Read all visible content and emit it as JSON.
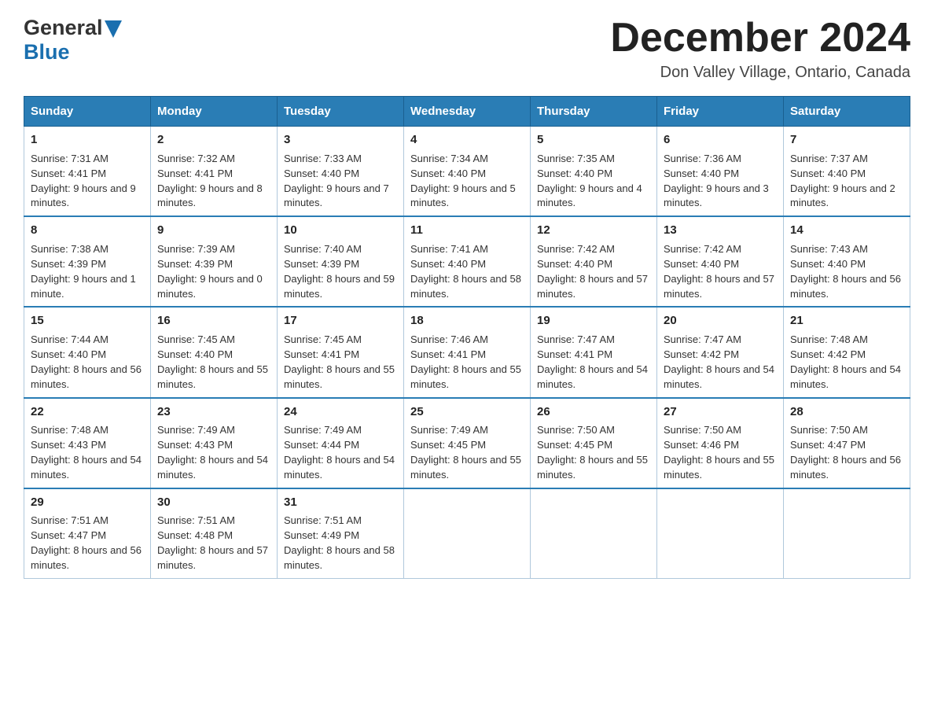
{
  "header": {
    "logo_general": "General",
    "logo_blue": "Blue",
    "month_title": "December 2024",
    "location": "Don Valley Village, Ontario, Canada"
  },
  "days_of_week": [
    "Sunday",
    "Monday",
    "Tuesday",
    "Wednesday",
    "Thursday",
    "Friday",
    "Saturday"
  ],
  "weeks": [
    [
      {
        "day": "1",
        "sunrise": "7:31 AM",
        "sunset": "4:41 PM",
        "daylight": "9 hours and 9 minutes."
      },
      {
        "day": "2",
        "sunrise": "7:32 AM",
        "sunset": "4:41 PM",
        "daylight": "9 hours and 8 minutes."
      },
      {
        "day": "3",
        "sunrise": "7:33 AM",
        "sunset": "4:40 PM",
        "daylight": "9 hours and 7 minutes."
      },
      {
        "day": "4",
        "sunrise": "7:34 AM",
        "sunset": "4:40 PM",
        "daylight": "9 hours and 5 minutes."
      },
      {
        "day": "5",
        "sunrise": "7:35 AM",
        "sunset": "4:40 PM",
        "daylight": "9 hours and 4 minutes."
      },
      {
        "day": "6",
        "sunrise": "7:36 AM",
        "sunset": "4:40 PM",
        "daylight": "9 hours and 3 minutes."
      },
      {
        "day": "7",
        "sunrise": "7:37 AM",
        "sunset": "4:40 PM",
        "daylight": "9 hours and 2 minutes."
      }
    ],
    [
      {
        "day": "8",
        "sunrise": "7:38 AM",
        "sunset": "4:39 PM",
        "daylight": "9 hours and 1 minute."
      },
      {
        "day": "9",
        "sunrise": "7:39 AM",
        "sunset": "4:39 PM",
        "daylight": "9 hours and 0 minutes."
      },
      {
        "day": "10",
        "sunrise": "7:40 AM",
        "sunset": "4:39 PM",
        "daylight": "8 hours and 59 minutes."
      },
      {
        "day": "11",
        "sunrise": "7:41 AM",
        "sunset": "4:40 PM",
        "daylight": "8 hours and 58 minutes."
      },
      {
        "day": "12",
        "sunrise": "7:42 AM",
        "sunset": "4:40 PM",
        "daylight": "8 hours and 57 minutes."
      },
      {
        "day": "13",
        "sunrise": "7:42 AM",
        "sunset": "4:40 PM",
        "daylight": "8 hours and 57 minutes."
      },
      {
        "day": "14",
        "sunrise": "7:43 AM",
        "sunset": "4:40 PM",
        "daylight": "8 hours and 56 minutes."
      }
    ],
    [
      {
        "day": "15",
        "sunrise": "7:44 AM",
        "sunset": "4:40 PM",
        "daylight": "8 hours and 56 minutes."
      },
      {
        "day": "16",
        "sunrise": "7:45 AM",
        "sunset": "4:40 PM",
        "daylight": "8 hours and 55 minutes."
      },
      {
        "day": "17",
        "sunrise": "7:45 AM",
        "sunset": "4:41 PM",
        "daylight": "8 hours and 55 minutes."
      },
      {
        "day": "18",
        "sunrise": "7:46 AM",
        "sunset": "4:41 PM",
        "daylight": "8 hours and 55 minutes."
      },
      {
        "day": "19",
        "sunrise": "7:47 AM",
        "sunset": "4:41 PM",
        "daylight": "8 hours and 54 minutes."
      },
      {
        "day": "20",
        "sunrise": "7:47 AM",
        "sunset": "4:42 PM",
        "daylight": "8 hours and 54 minutes."
      },
      {
        "day": "21",
        "sunrise": "7:48 AM",
        "sunset": "4:42 PM",
        "daylight": "8 hours and 54 minutes."
      }
    ],
    [
      {
        "day": "22",
        "sunrise": "7:48 AM",
        "sunset": "4:43 PM",
        "daylight": "8 hours and 54 minutes."
      },
      {
        "day": "23",
        "sunrise": "7:49 AM",
        "sunset": "4:43 PM",
        "daylight": "8 hours and 54 minutes."
      },
      {
        "day": "24",
        "sunrise": "7:49 AM",
        "sunset": "4:44 PM",
        "daylight": "8 hours and 54 minutes."
      },
      {
        "day": "25",
        "sunrise": "7:49 AM",
        "sunset": "4:45 PM",
        "daylight": "8 hours and 55 minutes."
      },
      {
        "day": "26",
        "sunrise": "7:50 AM",
        "sunset": "4:45 PM",
        "daylight": "8 hours and 55 minutes."
      },
      {
        "day": "27",
        "sunrise": "7:50 AM",
        "sunset": "4:46 PM",
        "daylight": "8 hours and 55 minutes."
      },
      {
        "day": "28",
        "sunrise": "7:50 AM",
        "sunset": "4:47 PM",
        "daylight": "8 hours and 56 minutes."
      }
    ],
    [
      {
        "day": "29",
        "sunrise": "7:51 AM",
        "sunset": "4:47 PM",
        "daylight": "8 hours and 56 minutes."
      },
      {
        "day": "30",
        "sunrise": "7:51 AM",
        "sunset": "4:48 PM",
        "daylight": "8 hours and 57 minutes."
      },
      {
        "day": "31",
        "sunrise": "7:51 AM",
        "sunset": "4:49 PM",
        "daylight": "8 hours and 58 minutes."
      },
      null,
      null,
      null,
      null
    ]
  ]
}
